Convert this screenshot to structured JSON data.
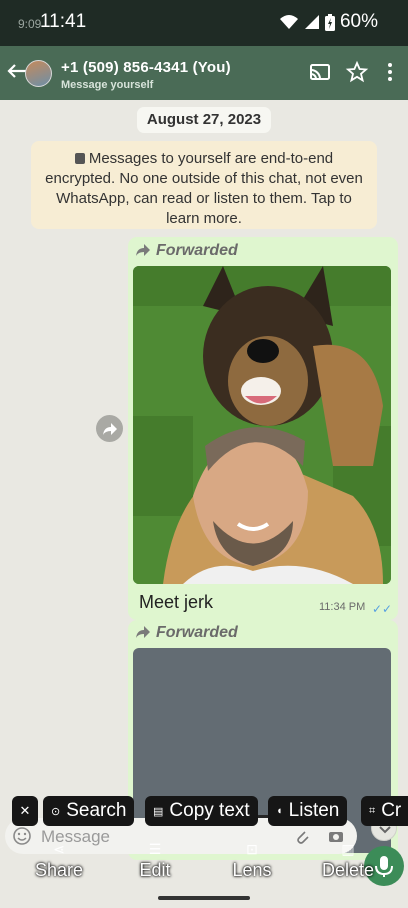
{
  "status_bar": {
    "time": "11:41",
    "ghost_time": "9:09",
    "battery": "60%"
  },
  "header": {
    "title": "+1 (509) 856-4341 (You)",
    "subtitle": "Message yourself"
  },
  "date_chip": "August 27, 2023",
  "notice": {
    "text": "Messages to yourself are end-to-end encrypted. No one outside of this chat, not even WhatsApp, can read or listen to them. Tap to learn more."
  },
  "messages": [
    {
      "forwarded_label": "Forwarded",
      "caption": "Meet jerk",
      "time": "11:34 PM",
      "status": "read"
    },
    {
      "forwarded_label": "Forwarded"
    }
  ],
  "lens_chips": {
    "search": "Search",
    "copy_text": "Copy text",
    "listen": "Listen",
    "crop": "Cr"
  },
  "composer": {
    "placeholder": "Message"
  },
  "bottom_actions": {
    "share": "Share",
    "edit": "Edit",
    "lens": "Lens",
    "delete": "Delete"
  },
  "colors": {
    "appbar": "#4a6b56",
    "bubble": "#dff6cf",
    "notice": "#f7edd4",
    "read_ticks": "#57a0e0",
    "mic": "#3c8c58"
  }
}
